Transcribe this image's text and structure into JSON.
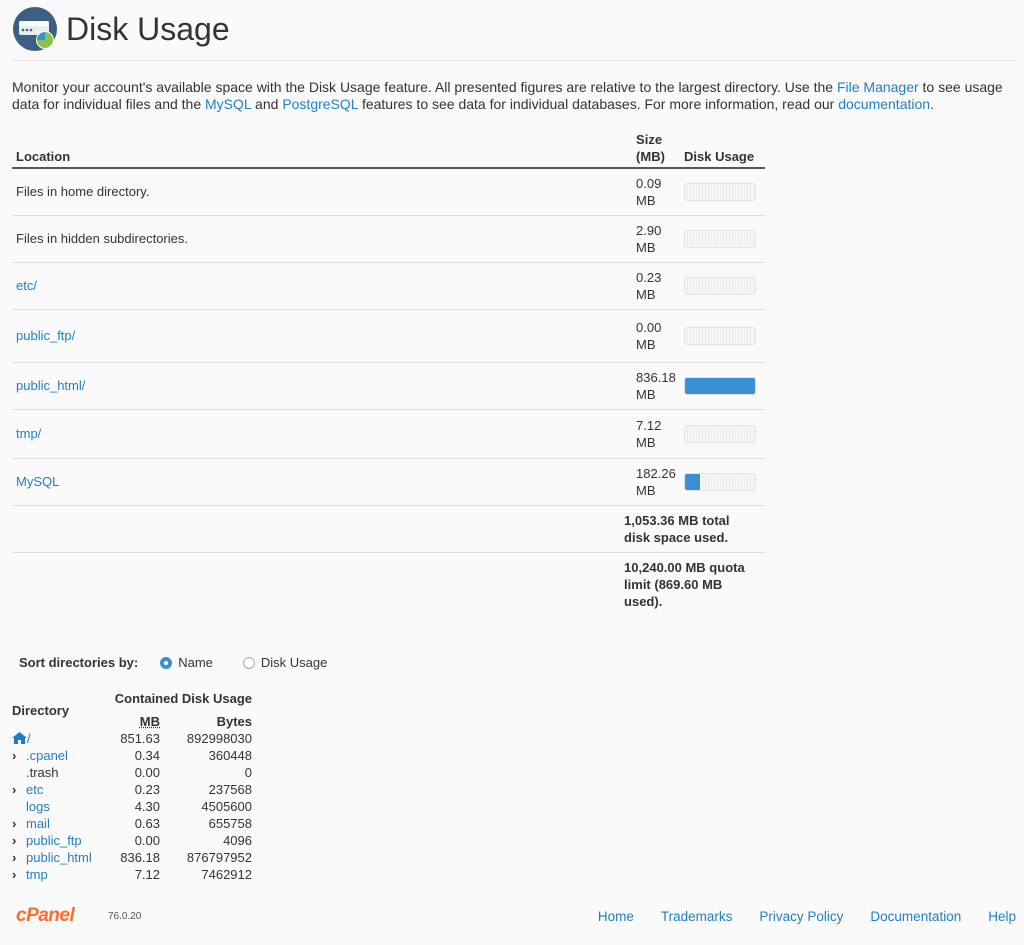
{
  "page": {
    "title": "Disk Usage"
  },
  "intro": {
    "t1": "Monitor your account's available space with the Disk Usage feature. All presented figures are relative to the largest directory. Use the ",
    "file_manager": "File Manager",
    "t2": " to see usage data for individual files and the ",
    "mysql": "MySQL",
    "t3": " and ",
    "postgres": "PostgreSQL",
    "t4": " features to see data for individual databases. For more information, read our ",
    "documentation": "documentation",
    "t5": "."
  },
  "usage_table": {
    "headers": {
      "location": "Location",
      "size": "Size (MB)",
      "disk_usage": "Disk Usage"
    },
    "rows": [
      {
        "location": "Files in home directory.",
        "size": "0.09 MB",
        "is_link": false,
        "usage_fraction": 0.0001
      },
      {
        "location": "Files in hidden subdirectories.",
        "size": "2.90 MB",
        "is_link": false,
        "usage_fraction": 0.003
      },
      {
        "location": "etc/",
        "size": "0.23 MB",
        "is_link": true,
        "usage_fraction": 0.0003
      },
      {
        "location": "public_ftp/",
        "size": "0.00 MB",
        "is_link": true,
        "usage_fraction": 0
      },
      {
        "location": "public_html/",
        "size": "836.18 MB",
        "is_link": true,
        "usage_fraction": 1.0
      },
      {
        "location": "tmp/",
        "size": "7.12 MB",
        "is_link": true,
        "usage_fraction": 0.0085
      },
      {
        "location": "MySQL",
        "size": "182.26 MB",
        "is_link": true,
        "usage_fraction": 0.218
      }
    ],
    "total": "1,053.36 MB total disk space used.",
    "quota": "10,240.00 MB quota limit (869.60 MB used)."
  },
  "sort": {
    "label": "Sort directories by:",
    "options": [
      {
        "label": "Name",
        "checked": true
      },
      {
        "label": "Disk Usage",
        "checked": false
      }
    ]
  },
  "dir_table": {
    "headers": {
      "directory": "Directory",
      "contained": "Contained Disk Usage",
      "mb": "MB",
      "bytes": "Bytes"
    },
    "rows": [
      {
        "name": "/",
        "mb": "851.63",
        "bytes": "892998030",
        "icon": "home-icon",
        "expandable": false,
        "is_home": true
      },
      {
        "name": ".cpanel",
        "mb": "0.34",
        "bytes": "360448",
        "expandable": true
      },
      {
        "name": ".trash",
        "mb": "0.00",
        "bytes": "0",
        "expandable": false
      },
      {
        "name": "etc",
        "mb": "0.23",
        "bytes": "237568",
        "expandable": true
      },
      {
        "name": "logs",
        "mb": "4.30",
        "bytes": "4505600",
        "expandable": false
      },
      {
        "name": "mail",
        "mb": "0.63",
        "bytes": "655758",
        "expandable": true
      },
      {
        "name": "public_ftp",
        "mb": "0.00",
        "bytes": "4096",
        "expandable": true
      },
      {
        "name": "public_html",
        "mb": "836.18",
        "bytes": "876797952",
        "expandable": true
      },
      {
        "name": "tmp",
        "mb": "7.12",
        "bytes": "7462912",
        "expandable": true
      }
    ]
  },
  "footer": {
    "logo": "cPanel",
    "version": "76.0.20",
    "links": [
      "Home",
      "Trademarks",
      "Privacy Policy",
      "Documentation",
      "Help"
    ]
  },
  "colors": {
    "accent": "#1f7fc4",
    "bar": "#3b8fd3",
    "logo": "#ff6c2c"
  }
}
